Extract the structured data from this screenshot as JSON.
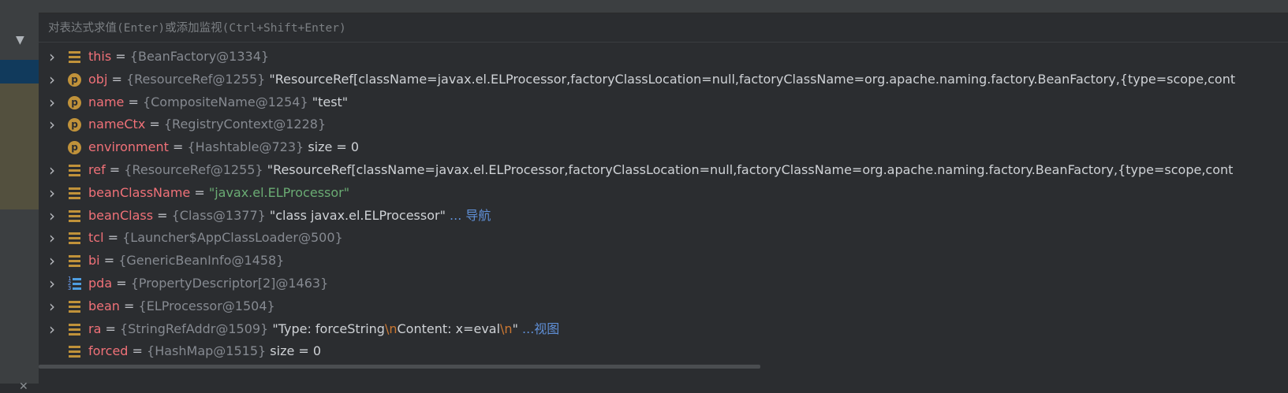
{
  "eval_bar": {
    "placeholder": "对表达式求值(Enter)或添加监视(Ctrl+Shift+Enter)"
  },
  "variables": [
    {
      "icon": "field-icon",
      "expandable": true,
      "name": "this",
      "type": "{BeanFactory@1334}",
      "value": ""
    },
    {
      "icon": "parameter-icon",
      "expandable": true,
      "name": "obj",
      "type": "{ResourceRef@1255}",
      "value": "\"ResourceRef[className=javax.el.ELProcessor,factoryClassLocation=null,factoryClassName=org.apache.naming.factory.BeanFactory,{type=scope,cont"
    },
    {
      "icon": "parameter-icon",
      "expandable": true,
      "name": "name",
      "type": "{CompositeName@1254}",
      "value": "\"test\""
    },
    {
      "icon": "parameter-icon",
      "expandable": true,
      "name": "nameCtx",
      "type": "{RegistryContext@1228}",
      "value": ""
    },
    {
      "icon": "parameter-icon",
      "expandable": false,
      "name": "environment",
      "type": "{Hashtable@723}",
      "value": " size = 0"
    },
    {
      "icon": "field-icon",
      "expandable": true,
      "name": "ref",
      "type": "{ResourceRef@1255}",
      "value": "\"ResourceRef[className=javax.el.ELProcessor,factoryClassLocation=null,factoryClassName=org.apache.naming.factory.BeanFactory,{type=scope,cont"
    },
    {
      "icon": "field-icon",
      "expandable": true,
      "name": "beanClassName",
      "type": "",
      "value": "\"javax.el.ELProcessor\""
    },
    {
      "icon": "field-icon",
      "expandable": true,
      "name": "beanClass",
      "type": "{Class@1377}",
      "value": "\"class javax.el.ELProcessor\"",
      "link": "... 导航"
    },
    {
      "icon": "field-icon",
      "expandable": true,
      "name": "tcl",
      "type": "{Launcher$AppClassLoader@500}",
      "value": ""
    },
    {
      "icon": "field-icon",
      "expandable": true,
      "name": "bi",
      "type": "{GenericBeanInfo@1458}",
      "value": ""
    },
    {
      "icon": "array-icon",
      "expandable": true,
      "name": "pda",
      "type": "{PropertyDescriptor[2]@1463}",
      "value": ""
    },
    {
      "icon": "field-icon",
      "expandable": true,
      "name": "bean",
      "type": "{ELProcessor@1504}",
      "value": ""
    },
    {
      "icon": "field-icon",
      "expandable": true,
      "name": "ra",
      "type": "{StringRefAddr@1509}",
      "value_parts": [
        "\"Type: forceString",
        "\\n",
        "Content: x=eval",
        "\\n",
        "\""
      ],
      "link": "...视图"
    },
    {
      "icon": "field-icon",
      "expandable": false,
      "name": "forced",
      "type": "{HashMap@1515}",
      "value": " size = 0"
    }
  ],
  "colors": {
    "background": "#2b2d30",
    "variable_name": "#f07178",
    "type_text": "#868a91",
    "string_value": "#cfd2d6",
    "green_string": "#6aab73",
    "link": "#5f8fd6",
    "escape": "#cc7832",
    "icon_field": "#c0923a"
  }
}
